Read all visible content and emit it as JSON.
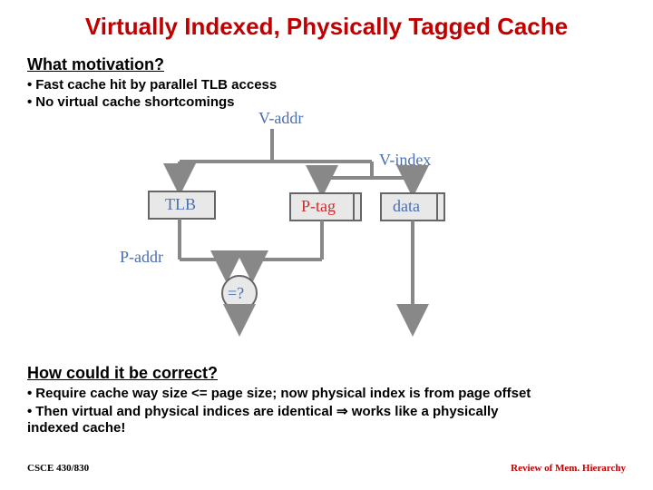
{
  "title": "Virtually Indexed, Physically Tagged Cache",
  "motivation_heading": "What motivation?",
  "bullet1": "Fast cache hit by parallel TLB access",
  "bullet2": "No virtual cache shortcomings",
  "correct_heading": "How could it be correct?",
  "bullet3": "Require cache way size <= page size; now physical index is from page offset",
  "bullet4": "Then virtual and physical indices are identical ⇒ works like a physically",
  "bullet5": "indexed cache!",
  "footer_left": "CSCE 430/830",
  "footer_right": "Review of Mem. Hierarchy",
  "diagram": {
    "vaddr": "V-addr",
    "vindex": "V-index",
    "tlb": "TLB",
    "ptag": "P-tag",
    "data": "data",
    "paddr": "P-addr",
    "eq": "=?"
  },
  "bullet_dot": "•"
}
